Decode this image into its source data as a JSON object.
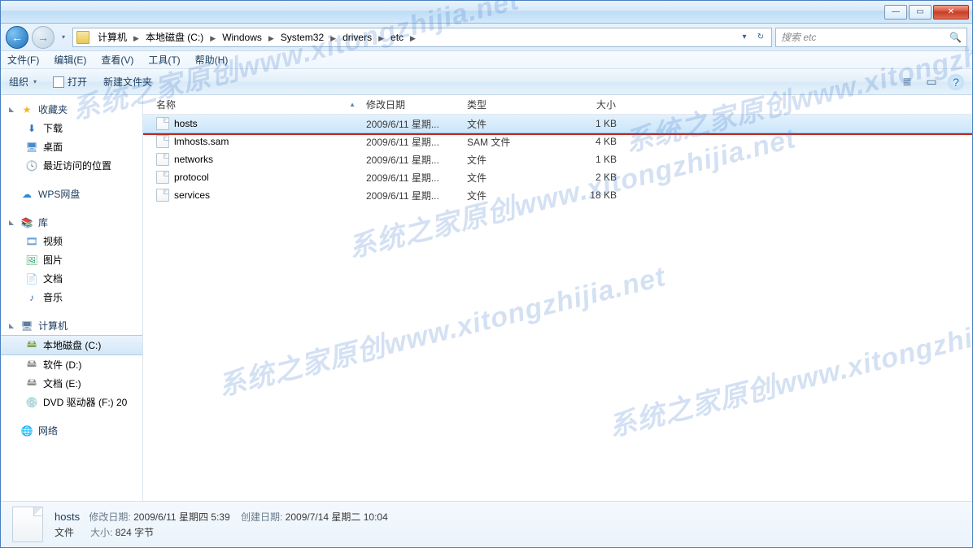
{
  "watermark": "系统之家原创www.xitongzhijia.net",
  "titlebar": {
    "min": "—",
    "max": "▭",
    "close": "✕"
  },
  "nav": {
    "back": "←",
    "fwd": "→",
    "drop": "▾",
    "refresh": "↻"
  },
  "breadcrumbs": [
    "计算机",
    "本地磁盘 (C:)",
    "Windows",
    "System32",
    "drivers",
    "etc"
  ],
  "search": {
    "placeholder": "搜索 etc",
    "icon": "🔍"
  },
  "menu": {
    "file": "文件(F)",
    "edit": "编辑(E)",
    "view": "查看(V)",
    "tools": "工具(T)",
    "help": "帮助(H)"
  },
  "toolbar": {
    "organize": "组织",
    "open": "打开",
    "newfolder": "新建文件夹",
    "view_icon": "≣",
    "help_icon": "?"
  },
  "sidebar": {
    "favorites": {
      "label": "收藏夹",
      "items": [
        {
          "icon": "⬇",
          "label": "下载"
        },
        {
          "icon": "🖥",
          "label": "桌面"
        },
        {
          "icon": "🕓",
          "label": "最近访问的位置"
        }
      ]
    },
    "wps": {
      "icon": "☁",
      "label": "WPS网盘"
    },
    "libraries": {
      "label": "库",
      "items": [
        {
          "icon": "🎞",
          "label": "视频"
        },
        {
          "icon": "🖼",
          "label": "图片"
        },
        {
          "icon": "📄",
          "label": "文档"
        },
        {
          "icon": "♪",
          "label": "音乐"
        }
      ]
    },
    "computer": {
      "label": "计算机",
      "items": [
        {
          "icon": "🖴",
          "label": "本地磁盘 (C:)",
          "selected": true
        },
        {
          "icon": "🖴",
          "label": "软件 (D:)"
        },
        {
          "icon": "🖴",
          "label": "文档 (E:)"
        },
        {
          "icon": "💿",
          "label": "DVD 驱动器 (F:) 20"
        }
      ]
    },
    "network": {
      "icon": "🌐",
      "label": "网络"
    }
  },
  "columns": {
    "name": "名称",
    "date": "修改日期",
    "type": "类型",
    "size": "大小"
  },
  "files": [
    {
      "name": "hosts",
      "date": "2009/6/11 星期...",
      "type": "文件",
      "size": "1 KB",
      "selected": true,
      "highlight": true
    },
    {
      "name": "lmhosts.sam",
      "date": "2009/6/11 星期...",
      "type": "SAM 文件",
      "size": "4 KB"
    },
    {
      "name": "networks",
      "date": "2009/6/11 星期...",
      "type": "文件",
      "size": "1 KB"
    },
    {
      "name": "protocol",
      "date": "2009/6/11 星期...",
      "type": "文件",
      "size": "2 KB"
    },
    {
      "name": "services",
      "date": "2009/6/11 星期...",
      "type": "文件",
      "size": "18 KB"
    }
  ],
  "details": {
    "filename": "hosts",
    "mod_label": "修改日期:",
    "mod_value": "2009/6/11 星期四 5:39",
    "create_label": "创建日期:",
    "create_value": "2009/7/14 星期二 10:04",
    "type_value": "文件",
    "size_label": "大小:",
    "size_value": "824 字节"
  }
}
